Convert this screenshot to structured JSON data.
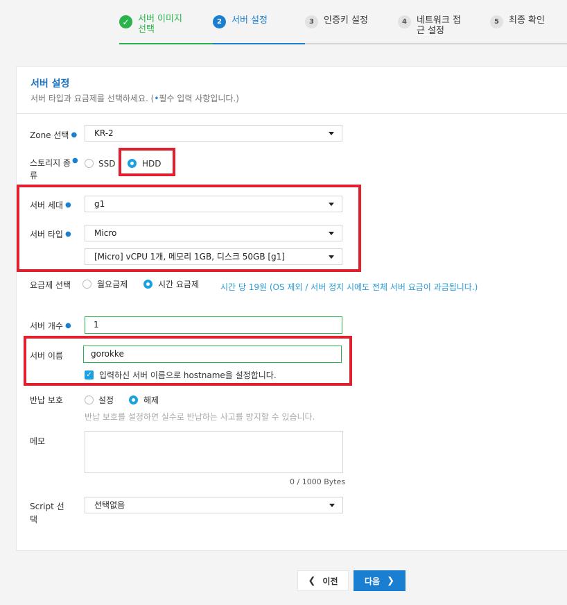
{
  "steps": [
    {
      "num": "✓",
      "label": "서버 이미지 선택",
      "state": "done"
    },
    {
      "num": "2",
      "label": "서버 설정",
      "state": "active"
    },
    {
      "num": "3",
      "label": "인증키 설정",
      "state": "todo"
    },
    {
      "num": "4",
      "label": "네트워크 접근 설정",
      "state": "todo"
    },
    {
      "num": "5",
      "label": "최종 확인",
      "state": "todo"
    }
  ],
  "section": {
    "title": "서버 설정",
    "subtitle_pre": "서버 타입과 요금제를 선택하세요. (",
    "subtitle_mark": "•",
    "subtitle_post": "필수 입력 사항입니다.)"
  },
  "form": {
    "zone": {
      "label": "Zone 선택",
      "value": "KR-2"
    },
    "storage": {
      "label": "스토리지 종류",
      "options": [
        "SSD",
        "HDD"
      ],
      "selected": "HDD"
    },
    "generation": {
      "label": "서버 세대",
      "value": "g1"
    },
    "server_type": {
      "label": "서버 타입",
      "value": "Micro",
      "spec_value": "[Micro] vCPU 1개, 메모리 1GB, 디스크 50GB [g1]"
    },
    "billing": {
      "label": "요금제 선택",
      "options": [
        "월요금제",
        "시간 요금제"
      ],
      "selected": "시간 요금제",
      "info": "시간 당 19원 (OS 제외 / 서버 정지 시에도 전체 서버 요금이 과금됩니다.)"
    },
    "count": {
      "label": "서버 개수",
      "value": "1"
    },
    "name": {
      "label": "서버 이름",
      "value": "gorokke",
      "checkbox_label": "입력하신 서버 이름으로 hostname을 설정합니다.",
      "checked": true
    },
    "protection": {
      "label": "반납 보호",
      "options": [
        "설정",
        "해제"
      ],
      "selected": "해제",
      "hint": "반납 보호를 설정하면 실수로 반납하는 사고를 방지할 수 있습니다."
    },
    "memo": {
      "label": "메모",
      "value": "",
      "counter": "0 / 1000 Bytes"
    },
    "script": {
      "label": "Script 선택",
      "value": "선택없음"
    }
  },
  "buttons": {
    "prev": "이전",
    "next": "다음"
  },
  "colors": {
    "accent": "#1b7fd1",
    "done": "#29b34a",
    "highlight": "#e0202e",
    "radio": "#1ba1e2"
  },
  "icons": {
    "prev": "chevron-left-icon",
    "next": "chevron-right-icon",
    "done": "check-icon"
  }
}
